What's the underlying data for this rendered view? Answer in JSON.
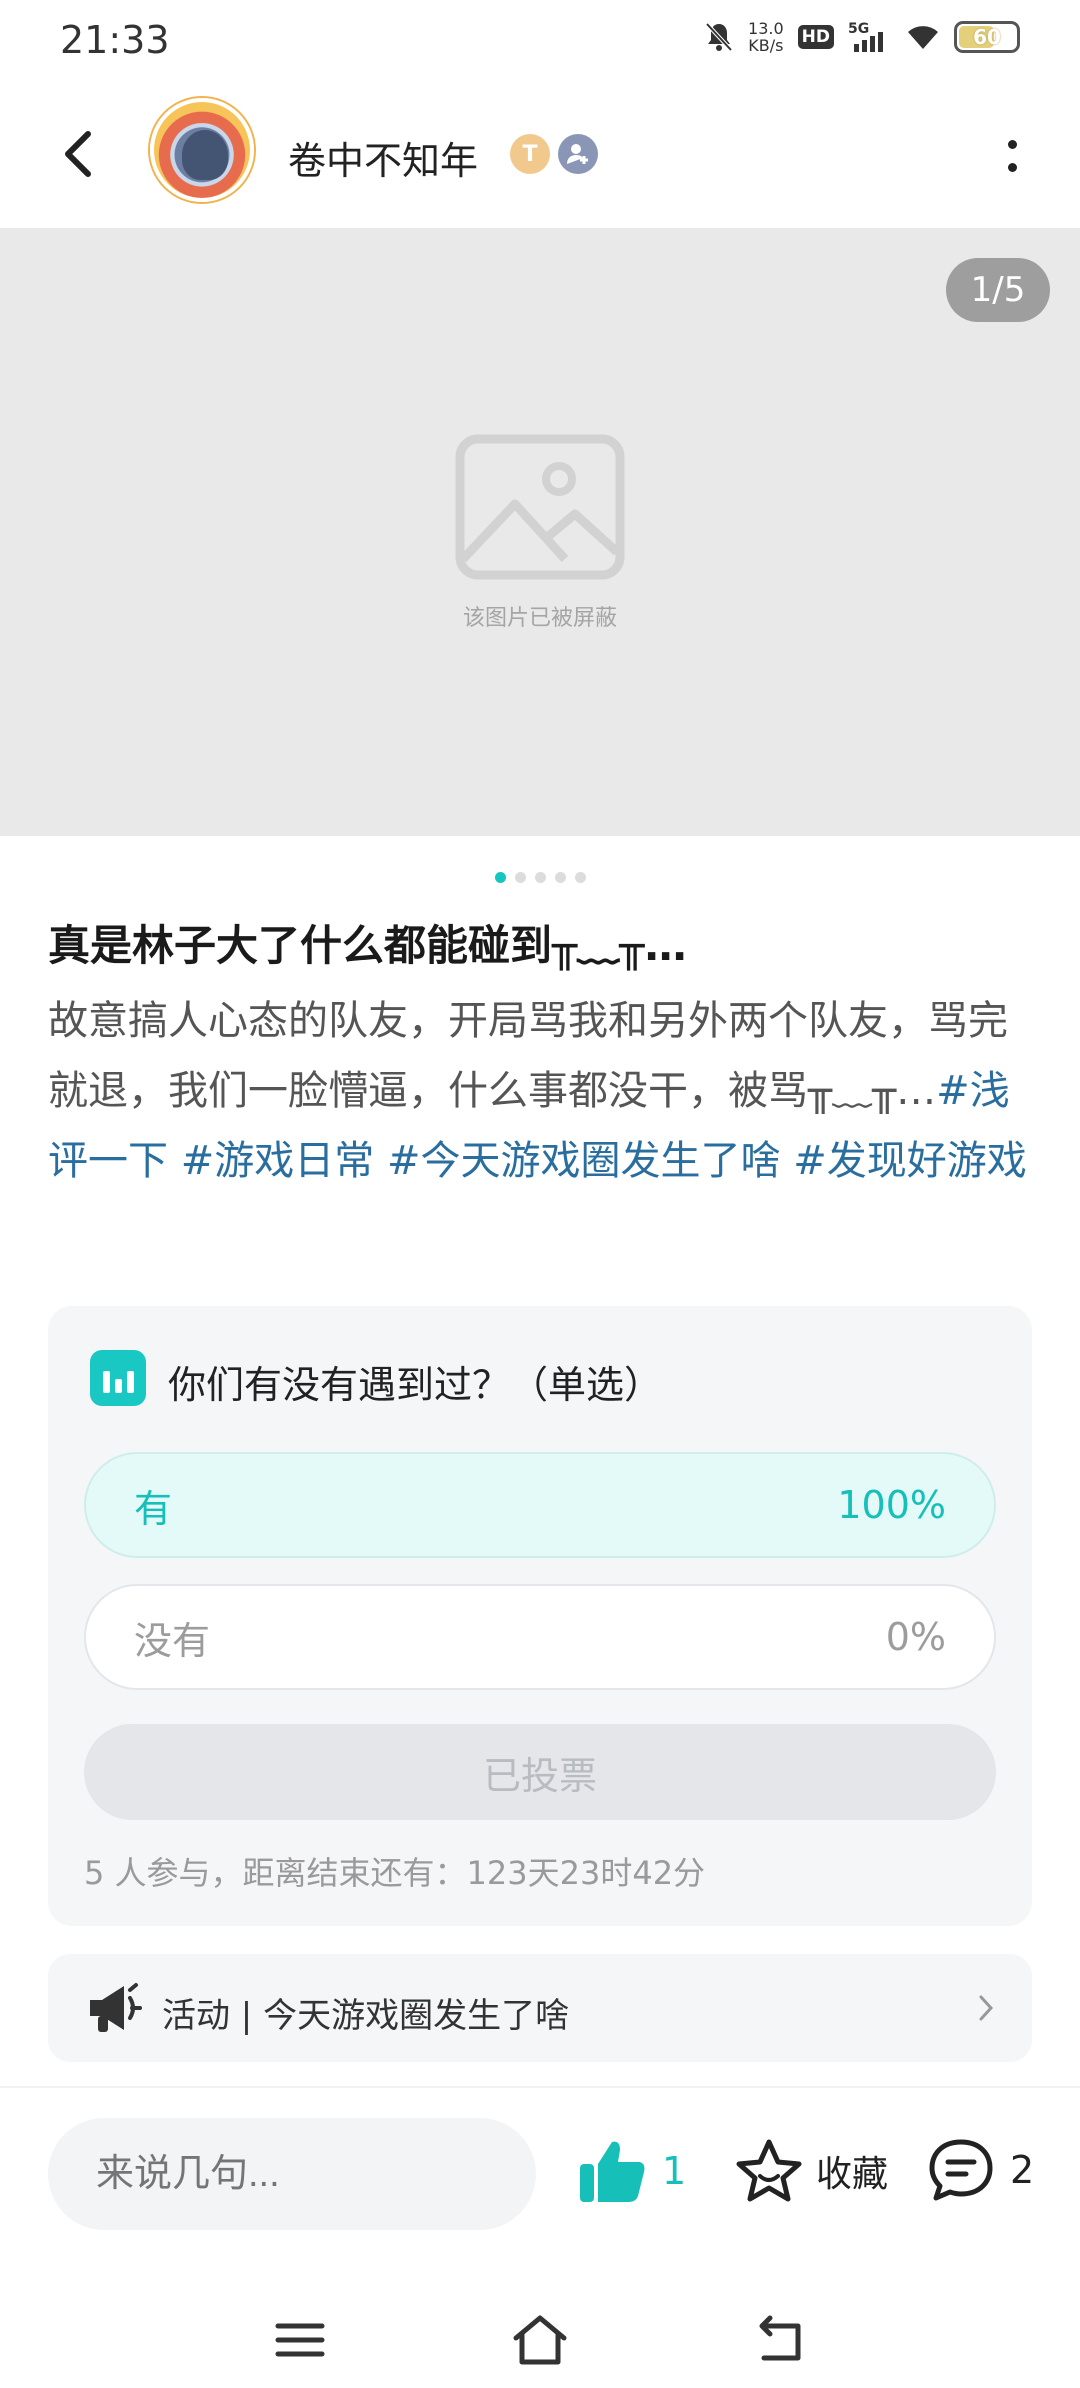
{
  "status_bar": {
    "time": "21:33",
    "net_speed_value": "13.0",
    "net_speed_unit": "KB/s",
    "hd": "HD",
    "signal": "5G",
    "battery": "60"
  },
  "header": {
    "username": "卷中不知年",
    "level_badge": "T"
  },
  "image": {
    "counter": "1/5",
    "blocked_text": "该图片已被屏蔽"
  },
  "post": {
    "title": "真是林子大了什么都能碰到╥﹏╥…",
    "body": "故意搞人心态的队友，开局骂我和另外两个队友，骂完就退，我们一脸懵逼，什么事都没干，被骂╥﹏╥…",
    "tags": [
      "#浅评一下",
      "#游戏日常",
      "#今天游戏圈发生了啥",
      "#发现好游戏"
    ]
  },
  "poll": {
    "question": "你们有没有遇到过？（单选）",
    "options": [
      {
        "label": "有",
        "percent": "100%"
      },
      {
        "label": "没有",
        "percent": "0%"
      }
    ],
    "vote_button": "已投票",
    "meta": "5 人参与，距离结束还有：123天23时42分"
  },
  "activity": {
    "text": "活动 | 今天游戏圈发生了啥"
  },
  "bottom_bar": {
    "comment_placeholder": "来说几句...",
    "like_count": "1",
    "favorite_label": "收藏",
    "comment_count": "2"
  },
  "colors": {
    "accent": "#16bfb8",
    "tag": "#2a6ea0"
  }
}
